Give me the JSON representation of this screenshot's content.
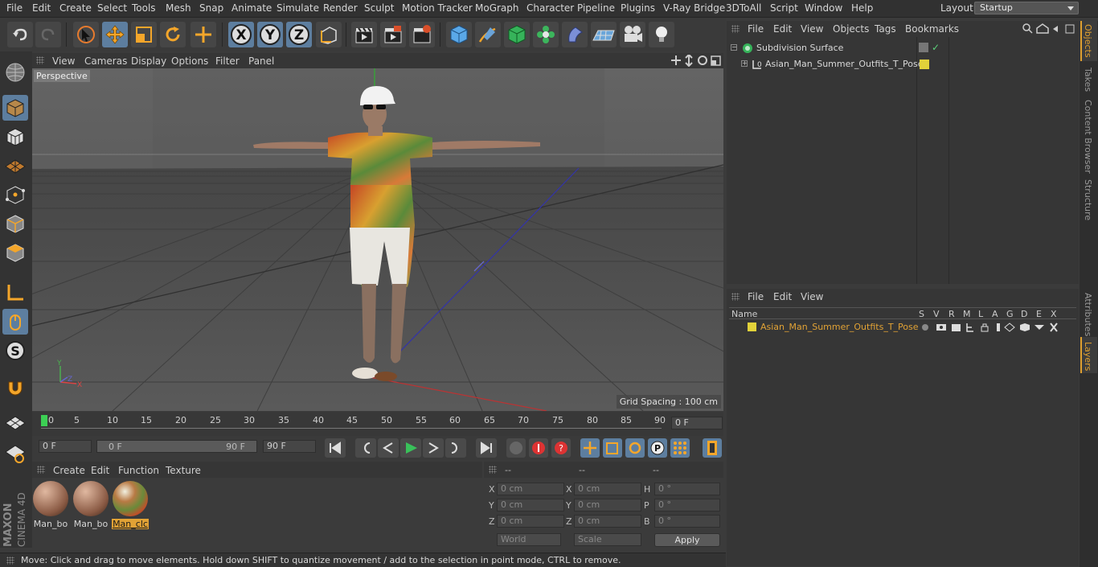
{
  "menu": [
    "File",
    "Edit",
    "Create",
    "Select",
    "Tools",
    "Mesh",
    "Snap",
    "Animate",
    "Simulate",
    "Render",
    "Sculpt",
    "Motion Tracker",
    "MoGraph",
    "Character",
    "Pipeline",
    "Plugins",
    "V-Ray Bridge",
    "3DToAll",
    "Script",
    "Window",
    "Help"
  ],
  "layout": {
    "label": "Layout:",
    "value": "Startup"
  },
  "viewport": {
    "menu": [
      "View",
      "Cameras",
      "Display",
      "Options",
      "Filter",
      "Panel"
    ],
    "name": "Perspective",
    "grid_spacing": "Grid Spacing : 100 cm"
  },
  "timeline": {
    "ticks": [
      "0",
      "5",
      "10",
      "15",
      "20",
      "25",
      "30",
      "35",
      "40",
      "45",
      "50",
      "55",
      "60",
      "65",
      "70",
      "75",
      "80",
      "85",
      "90"
    ],
    "current": "0 F",
    "start": "0 F",
    "range_start": "0 F",
    "range_end": "90 F",
    "end": "90 F"
  },
  "materials": {
    "menu": [
      "Create",
      "Edit",
      "Function",
      "Texture"
    ],
    "items": [
      {
        "name": "Man_bo",
        "selected": false
      },
      {
        "name": "Man_bo",
        "selected": false
      },
      {
        "name": "Man_clc",
        "selected": true
      }
    ]
  },
  "coords": {
    "headers": [
      "--",
      "--",
      "--"
    ],
    "rows": [
      {
        "a": "X",
        "av": "0 cm",
        "b": "X",
        "bv": "0 cm",
        "c": "H",
        "cv": "0 °"
      },
      {
        "a": "Y",
        "av": "0 cm",
        "b": "Y",
        "bv": "0 cm",
        "c": "P",
        "cv": "0 °"
      },
      {
        "a": "Z",
        "av": "0 cm",
        "b": "Z",
        "bv": "0 cm",
        "c": "B",
        "cv": "0 °"
      }
    ],
    "world": "World",
    "scale": "Scale",
    "apply": "Apply"
  },
  "objects": {
    "menu": [
      "File",
      "Edit",
      "View",
      "Objects",
      "Tags",
      "Bookmarks"
    ],
    "items": [
      "Subdivision Surface",
      "Asian_Man_Summer_Outfits_T_Pose"
    ]
  },
  "layers": {
    "menu": [
      "File",
      "Edit",
      "View"
    ],
    "columns": [
      "Name",
      "S",
      "V",
      "R",
      "M",
      "L",
      "A",
      "G",
      "D",
      "E",
      "X"
    ],
    "item": "Asian_Man_Summer_Outfits_T_Pose",
    "accent": "#e1a235"
  },
  "side_tabs": [
    "Objects",
    "Takes",
    "Content Browser",
    "Structure",
    "Attributes",
    "Layers"
  ],
  "status": "Move: Click and drag to move elements. Hold down SHIFT to quantize movement / add to the selection in point mode, CTRL to remove.",
  "brand": [
    "MAXON",
    "CINEMA 4D"
  ]
}
